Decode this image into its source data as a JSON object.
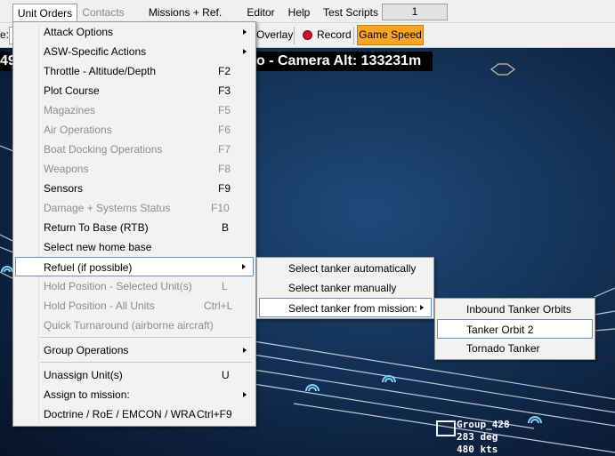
{
  "menubar": {
    "items": [
      {
        "label": "Unit Orders",
        "state": "open"
      },
      {
        "label": "Contacts",
        "state": "dim"
      },
      {
        "label": "Missions + Ref. Points"
      },
      {
        "label": "Editor"
      },
      {
        "label": "Help"
      },
      {
        "label": "Test Scripts"
      }
    ],
    "counter_value": "1"
  },
  "toolbar": {
    "left_fragment": "e:",
    "overlay_label": "Overlay",
    "record_label": "Record",
    "game_speed_label": "Game Speed",
    "accent_color": "#f8a524"
  },
  "map": {
    "left_fragment": "49",
    "camera_text": "o -  Camera Alt: 133231m",
    "unit": {
      "name": "Group_428",
      "heading": "283 deg",
      "speed": "480 kts"
    }
  },
  "unit_orders_menu": {
    "items": [
      {
        "label": "Attack Options",
        "shortcut": "",
        "submenu": true,
        "enabled": true
      },
      {
        "label": "ASW-Specific Actions",
        "shortcut": "",
        "submenu": true,
        "enabled": true
      },
      {
        "label": "Throttle - Altitude/Depth",
        "shortcut": "F2",
        "submenu": false,
        "enabled": true
      },
      {
        "label": "Plot Course",
        "shortcut": "F3",
        "submenu": false,
        "enabled": true
      },
      {
        "label": "Magazines",
        "shortcut": "F5",
        "submenu": false,
        "enabled": false
      },
      {
        "label": "Air Operations",
        "shortcut": "F6",
        "submenu": false,
        "enabled": false
      },
      {
        "label": "Boat Docking Operations",
        "shortcut": "F7",
        "submenu": false,
        "enabled": false
      },
      {
        "label": "Weapons",
        "shortcut": "F8",
        "submenu": false,
        "enabled": false
      },
      {
        "label": "Sensors",
        "shortcut": "F9",
        "submenu": false,
        "enabled": true
      },
      {
        "label": "Damage + Systems Status",
        "shortcut": "F10",
        "submenu": false,
        "enabled": false
      },
      {
        "label": "Return To Base (RTB)",
        "shortcut": "B",
        "submenu": false,
        "enabled": true
      },
      {
        "label": "Select new home base",
        "shortcut": "",
        "submenu": false,
        "enabled": true
      },
      {
        "label": "Refuel (if possible)",
        "shortcut": "",
        "submenu": true,
        "enabled": true,
        "highlighted": true
      },
      {
        "label": "Hold Position - Selected Unit(s)",
        "shortcut": "L",
        "submenu": false,
        "enabled": false
      },
      {
        "label": "Hold Position - All Units",
        "shortcut": "Ctrl+L",
        "submenu": false,
        "enabled": false
      },
      {
        "label": "Quick Turnaround (airborne aircraft)",
        "shortcut": "",
        "submenu": false,
        "enabled": false
      },
      {
        "label": "Group Operations",
        "shortcut": "",
        "submenu": true,
        "enabled": true
      },
      {
        "label": "Unassign Unit(s)",
        "shortcut": "U",
        "submenu": false,
        "enabled": true
      },
      {
        "label": "Assign to mission:",
        "shortcut": "",
        "submenu": true,
        "enabled": true
      },
      {
        "label": "Doctrine / RoE / EMCON / WRA",
        "shortcut": "Ctrl+F9",
        "submenu": false,
        "enabled": true
      }
    ]
  },
  "refuel_menu": {
    "items": [
      {
        "label": "Select tanker automatically",
        "submenu": false
      },
      {
        "label": "Select tanker manually",
        "submenu": false
      },
      {
        "label": "Select tanker from mission:",
        "submenu": true,
        "highlighted": true
      }
    ]
  },
  "mission_menu": {
    "items": [
      {
        "label": "Inbound Tanker Orbits"
      },
      {
        "label": "Tanker Orbit 2",
        "highlighted": true
      },
      {
        "label": "Tornado Tanker"
      }
    ]
  }
}
